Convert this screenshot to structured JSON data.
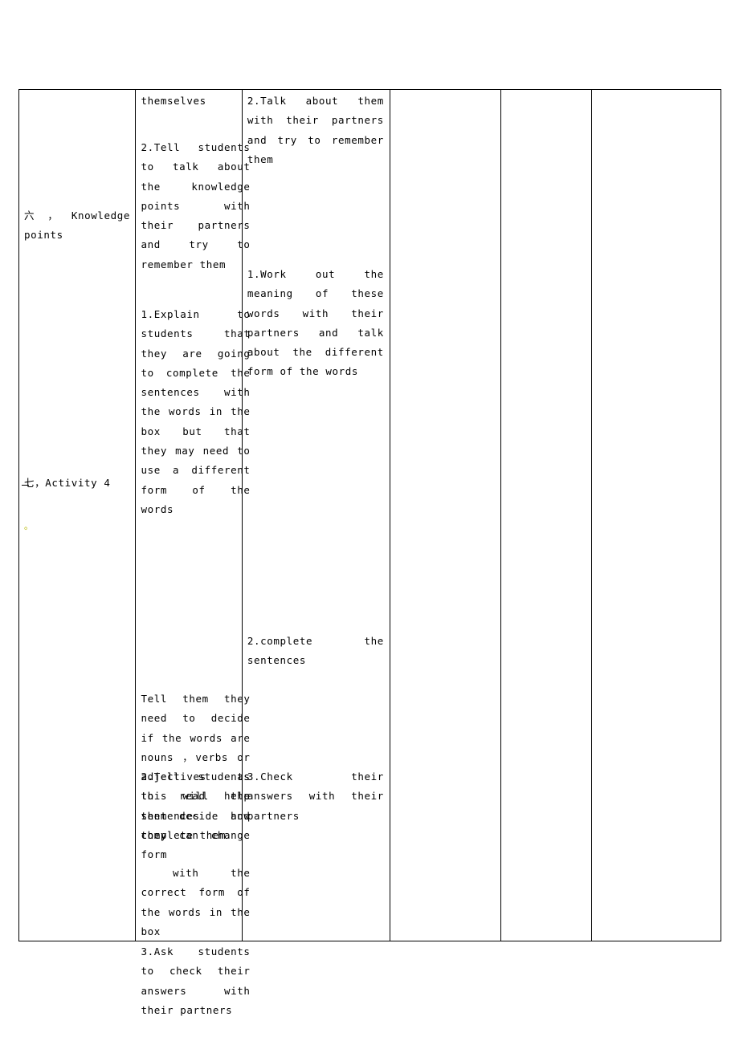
{
  "document": {
    "table": {
      "columns": [
        "stage",
        "teacher_activity",
        "student_activity",
        "blank1",
        "blank2",
        "blank3"
      ],
      "cells": {
        "stage": {
          "knowledge_points": "六 ， Knowledge points",
          "activity4": "七，Activity 4",
          "mark": "。"
        },
        "teacher_activity": {
          "b1": "themselves",
          "b2": "2.Tell students to talk about the knowledge points with their partners and try to remember them",
          "b3": "1.Explain to students that they are going to complete the sentences with the words in the box but that they may need to use a different form of the words",
          "b4": "Tell them they need to decide if the words are nouns ，verbs or adjectives as this will help them decide how they can change form",
          "b5": "2.Tell students to read the sentences and complete them",
          "b6": " with the correct form of the words in the box",
          "b7": "3.Ask students to check their answers with their partners"
        },
        "student_activity": {
          "b1": "2.Talk about them with their partners and try to remember them",
          "b2": "1.Work out the meaning of these words with their partners and talk about the different form of the words",
          "b3": "2.complete the sentences",
          "b4": "3.Check their answers with their partners"
        },
        "blank1": "",
        "blank2": "",
        "blank3": ""
      }
    }
  }
}
